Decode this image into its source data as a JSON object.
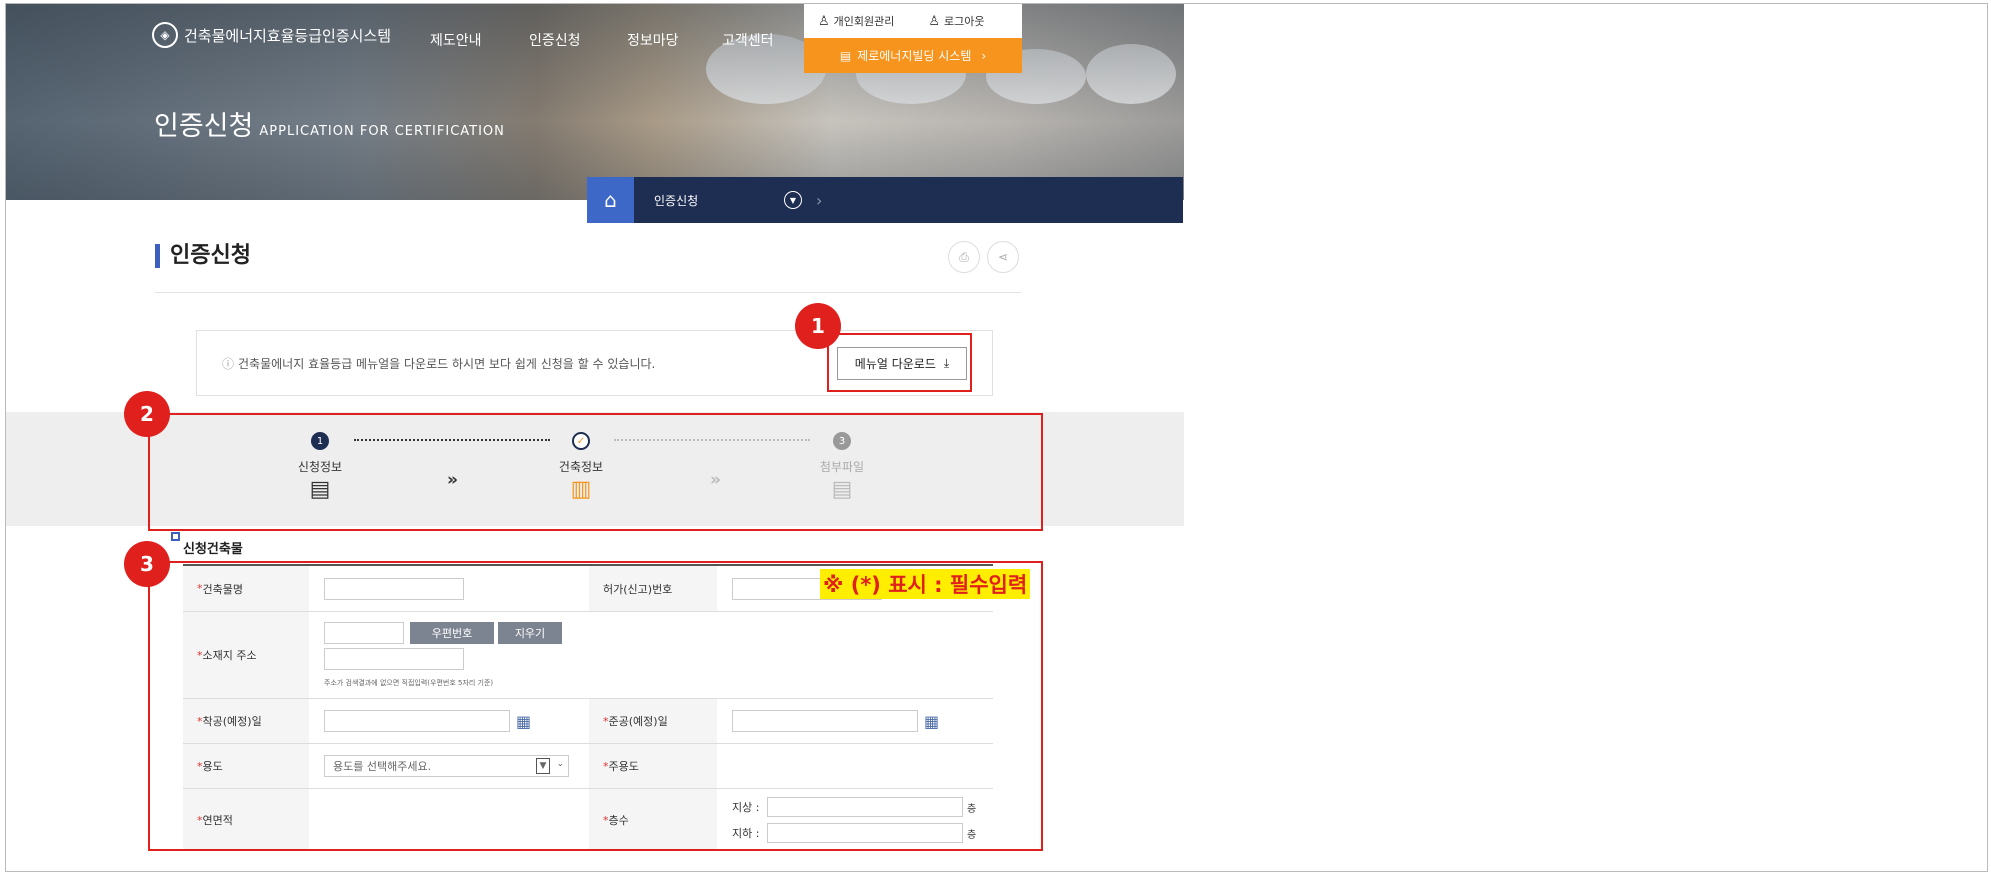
{
  "site": {
    "name": "건축물에너지효율등급인증시스템"
  },
  "gnb": [
    "제도안내",
    "인증신청",
    "정보마당",
    "고객센터"
  ],
  "util": {
    "member": "개인회원관리",
    "logout": "로그아웃",
    "zero": "제로에너지빌딩 시스템"
  },
  "banner": {
    "title": "인증신청",
    "subtitle": "APPLICATION FOR CERTIFICATION"
  },
  "breadcrumb": {
    "current": "인증신청"
  },
  "page": {
    "title": "인증신청"
  },
  "notice": {
    "text": "건축물에너지 효율등급 메뉴얼을 다운로드 하시면 보다 쉽게 신청을 할 수 있습니다.",
    "button": "메뉴얼 다운로드"
  },
  "steps": [
    {
      "num": "1",
      "label": "신청정보"
    },
    {
      "num": "✓",
      "label": "건축정보"
    },
    {
      "num": "3",
      "label": "첨부파일"
    }
  ],
  "form": {
    "section_title": "신청건축물",
    "required_note": "※ (*) 표시 : 필수입력",
    "building_name": "건축물명",
    "permit_no": "허가(신고)번호",
    "address": "소재지 주소",
    "zip_button": "우편번호",
    "clear_button": "지우기",
    "address_hint": "주소가 검색결과에 없으면 직접입력(우편번호 5자리 기준)",
    "start_date": "착공(예정)일",
    "complete_date": "준공(예정)일",
    "use": "용도",
    "use_placeholder": "용도를 선택해주세요.",
    "main_use": "주용도",
    "area": "연면적",
    "floors": "층수",
    "above": "지상 :",
    "below": "지하 :",
    "floor_unit": "층"
  },
  "annotations": [
    "1",
    "2",
    "3"
  ],
  "colors": {
    "accent_orange": "#f7941d",
    "nav_dark": "#1e2d52",
    "home_blue": "#3d68c8",
    "annotation_red": "#e0201c",
    "highlight": "#ffee00"
  }
}
